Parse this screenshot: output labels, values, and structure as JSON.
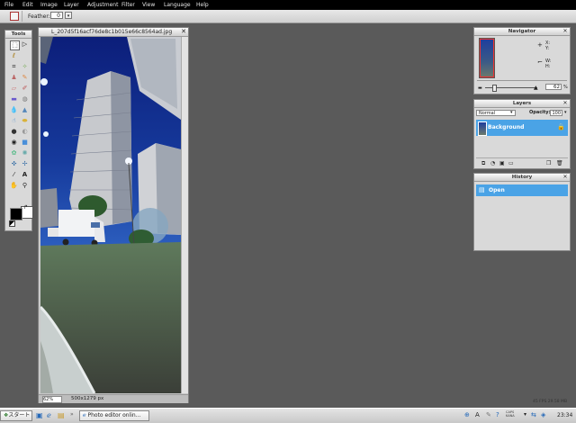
{
  "menu": [
    "File",
    "Edit",
    "Image",
    "Layer",
    "Adjustment",
    "Filter",
    "View",
    "Language",
    "Help"
  ],
  "options": {
    "feather_label": "Feather:",
    "feather_value": "0"
  },
  "tools": {
    "title": "Tools"
  },
  "image_window": {
    "title": "L_207d5f16acf76de8c1b015e66c8564ad.jpg",
    "zoom": "62",
    "zoom_unit": "%",
    "size": "500x1279 px"
  },
  "navigator": {
    "title": "Navigator",
    "x_label": "X:",
    "y_label": "Y:",
    "w_label": "W:",
    "h_label": "H:",
    "zoom": "62",
    "zoom_unit": "%"
  },
  "layers": {
    "title": "Layers",
    "blend_mode": "Normal",
    "opacity_label": "Opacity:",
    "opacity_value": "100",
    "layer_name": "Background"
  },
  "history": {
    "title": "History",
    "item": "Open"
  },
  "status": {
    "fps": "45 FPS 29.58 MB"
  },
  "taskbar": {
    "start": "スタート",
    "app": "Photo editor onlin...",
    "tray_a": "A",
    "tray_ime1": "CAPS",
    "tray_ime2": "KANA",
    "time": "23:34"
  },
  "colors": {
    "selection": "#4aa3e6",
    "background": "#5a5a5a",
    "menubar": "#000000"
  }
}
